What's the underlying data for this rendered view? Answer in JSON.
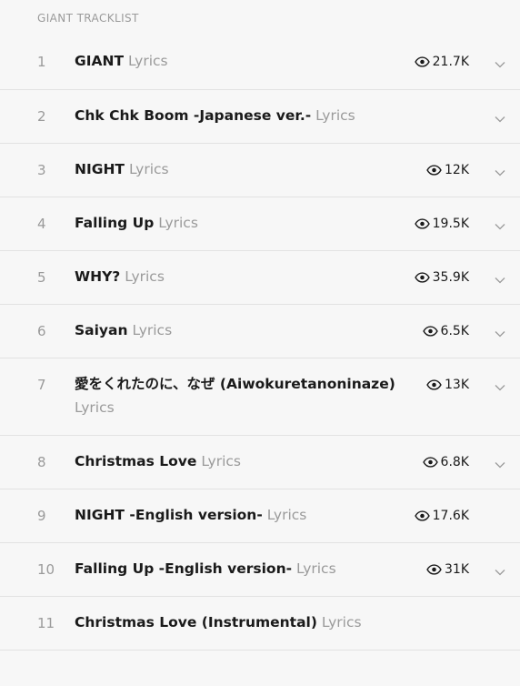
{
  "tracklist": {
    "header": "GIANT TRACKLIST",
    "tracks": [
      {
        "number": "1",
        "title": "GIANT",
        "lyrics": "Lyrics",
        "views": "21.7K",
        "expandable": true
      },
      {
        "number": "2",
        "title": "Chk Chk Boom -Japanese ver.-",
        "lyrics": "Lyrics",
        "views": "",
        "expandable": true
      },
      {
        "number": "3",
        "title": "NIGHT",
        "lyrics": "Lyrics",
        "views": "12K",
        "expandable": true
      },
      {
        "number": "4",
        "title": "Falling Up",
        "lyrics": "Lyrics",
        "views": "19.5K",
        "expandable": true
      },
      {
        "number": "5",
        "title": "WHY?",
        "lyrics": "Lyrics",
        "views": "35.9K",
        "expandable": true
      },
      {
        "number": "6",
        "title": "Saiyan",
        "lyrics": "Lyrics",
        "views": "6.5K",
        "expandable": true
      },
      {
        "number": "7",
        "title": "愛をくれたのに、なぜ (Aiwokuretanoninaze)",
        "lyrics": "Lyrics",
        "views": "13K",
        "expandable": true
      },
      {
        "number": "8",
        "title": "Christmas Love",
        "lyrics": "Lyrics",
        "views": "6.8K",
        "expandable": true
      },
      {
        "number": "9",
        "title": "NIGHT -English version-",
        "lyrics": "Lyrics",
        "views": "17.6K",
        "expandable": false
      },
      {
        "number": "10",
        "title": "Falling Up -English version-",
        "lyrics": "Lyrics",
        "views": "31K",
        "expandable": true
      },
      {
        "number": "11",
        "title": "Christmas Love (Instrumental)",
        "lyrics": "Lyrics",
        "views": "",
        "expandable": false
      }
    ]
  },
  "icons": {
    "views": "eye-icon",
    "expand": "chevron-down-icon"
  },
  "colors": {
    "background": "#f7f7f7",
    "divider": "#e2e2e2",
    "muted_text": "#9a9a9a",
    "primary_text": "#1a1a1a"
  }
}
